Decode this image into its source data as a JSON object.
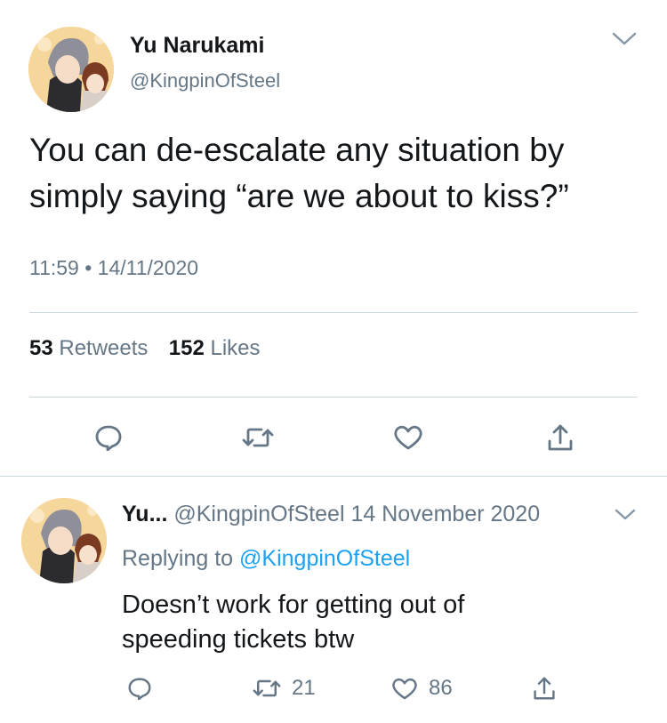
{
  "main_tweet": {
    "display_name": "Yu Narukami",
    "handle": "@KingpinOfSteel",
    "text_line1": "You can de-escalate any situation by",
    "text_line2": "simply saying “are we about to kiss?”",
    "timestamp": "11:59 • 14/11/2020",
    "retweet_count": "53",
    "retweet_label": "Retweets",
    "like_count": "152",
    "like_label": "Likes"
  },
  "reply": {
    "display_name": "Yu...",
    "handle": "@KingpinOfSteel",
    "date": "14 November 2020",
    "replying_prefix": "Replying to",
    "replying_handle": "@KingpinOfSteel",
    "text_line1": "Doesn’t work for getting out of",
    "text_line2": "speeding tickets btw",
    "retweet_count": "21",
    "like_count": "86"
  },
  "icons": {
    "more": "chevron-down-icon",
    "reply": "reply-bubble-icon",
    "retweet": "retweet-icon",
    "like": "heart-icon",
    "share": "share-icon"
  },
  "colors": {
    "text": "#14171a",
    "secondary": "#657786",
    "link": "#1da1f2",
    "divider": "#ccd6dd"
  }
}
